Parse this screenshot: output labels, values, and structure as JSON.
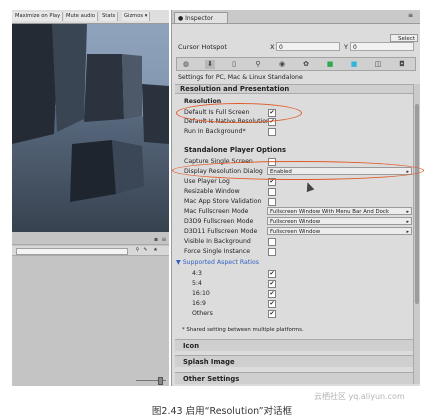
{
  "game_view": {
    "toolbar": [
      "Maximize on Play",
      "Mute audio",
      "Stats",
      "Gizmos ▾"
    ]
  },
  "inspector": {
    "tab_label": "Inspector",
    "select_label": "Select",
    "cursor_hotspot": {
      "label": "Cursor Hotspot",
      "x_label": "X",
      "x_value": "0",
      "y_label": "Y",
      "y_value": "0"
    },
    "settings_for": "Settings for PC, Mac & Linux Standalone",
    "section_title": "Resolution and Presentation",
    "resolution_header": "Resolution",
    "resolution_rows": [
      {
        "label": "Default Is Full Screen",
        "checked": true
      },
      {
        "label": "Default Is Native Resolution",
        "checked": true
      },
      {
        "label": "Run In Background*",
        "checked": false
      }
    ],
    "standalone_header": "Standalone Player Options",
    "standalone_rows": [
      {
        "label": "Capture Single Screen",
        "checked": false
      },
      {
        "label": "Display Resolution Dialog",
        "dropdown": "Enabled"
      },
      {
        "label": "Use Player Log",
        "checked": true
      },
      {
        "label": "Resizable Window",
        "checked": false
      },
      {
        "label": "Mac App Store Validation",
        "checked": false
      },
      {
        "label": "Mac Fullscreen Mode",
        "dropdown": "Fullscreen Window With Menu Bar And Dock"
      },
      {
        "label": "D3D9 Fullscreen Mode",
        "dropdown": "Fullscreen Window"
      },
      {
        "label": "D3D11 Fullscreen Mode",
        "dropdown": "Fullscreen Window"
      },
      {
        "label": "Visible In Background",
        "checked": false
      },
      {
        "label": "Force Single Instance",
        "checked": false
      }
    ],
    "aspect_header": "▼ Supported Aspect Ratios",
    "aspect_rows": [
      {
        "label": "4:3",
        "checked": true
      },
      {
        "label": "5:4",
        "checked": true
      },
      {
        "label": "16:10",
        "checked": true
      },
      {
        "label": "16:9",
        "checked": true
      },
      {
        "label": "Others",
        "checked": true
      }
    ],
    "note": "* Shared setting between multiple platforms.",
    "collapsed_sections": [
      "Icon",
      "Splash Image",
      "Other Settings"
    ]
  },
  "caption": "图2.43   启用“Resolution”对话框",
  "watermark": "云栖社区 yq.aliyun.com",
  "colors": {
    "highlight": "#e05a28",
    "link": "#3060c0"
  }
}
